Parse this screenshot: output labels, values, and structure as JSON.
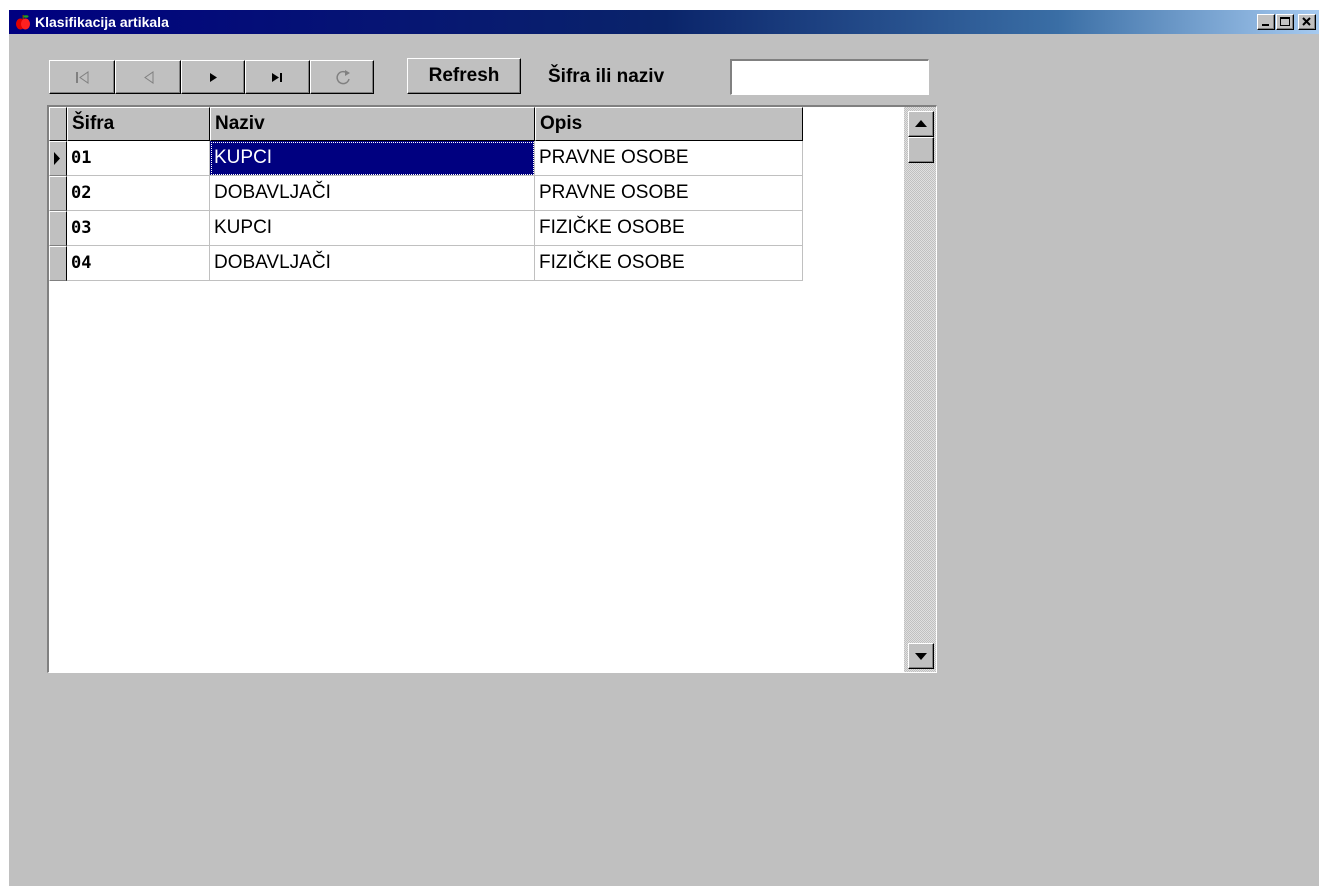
{
  "window": {
    "title": "Klasifikacija artikala",
    "icon": "apple-icon",
    "controls": [
      "minimize-icon",
      "maximize-icon",
      "close-icon"
    ]
  },
  "toolbar": {
    "nav_buttons": [
      {
        "name": "first-record",
        "icon": "skip-first-icon",
        "enabled": false
      },
      {
        "name": "prior-record",
        "icon": "triangle-left-icon",
        "enabled": false
      },
      {
        "name": "next-record",
        "icon": "triangle-right-icon",
        "enabled": true
      },
      {
        "name": "last-record",
        "icon": "skip-last-icon",
        "enabled": true
      },
      {
        "name": "refresh-record",
        "icon": "refresh-icon",
        "enabled": false
      }
    ],
    "refresh_label": "Refresh",
    "search_label": "Šifra ili naziv",
    "search_value": "",
    "search_placeholder": ""
  },
  "grid": {
    "columns": [
      "Šifra",
      "Naziv",
      "Opis"
    ],
    "rows": [
      {
        "sifra": "01",
        "naziv": "KUPCI",
        "opis": "PRAVNE OSOBE"
      },
      {
        "sifra": "02",
        "naziv": "DOBAVLJAČI",
        "opis": "PRAVNE OSOBE"
      },
      {
        "sifra": "03",
        "naziv": "KUPCI",
        "opis": "FIZIČKE OSOBE"
      },
      {
        "sifra": "04",
        "naziv": "DOBAVLJAČI",
        "opis": "FIZIČKE OSOBE"
      }
    ],
    "current_row_index": 0,
    "selected_cell": "naziv"
  },
  "colors": {
    "face": "#c0c0c0",
    "title_start": "#000080",
    "title_end": "#a6caf0",
    "selection": "#000080",
    "disabled_glyph": "#808080"
  }
}
